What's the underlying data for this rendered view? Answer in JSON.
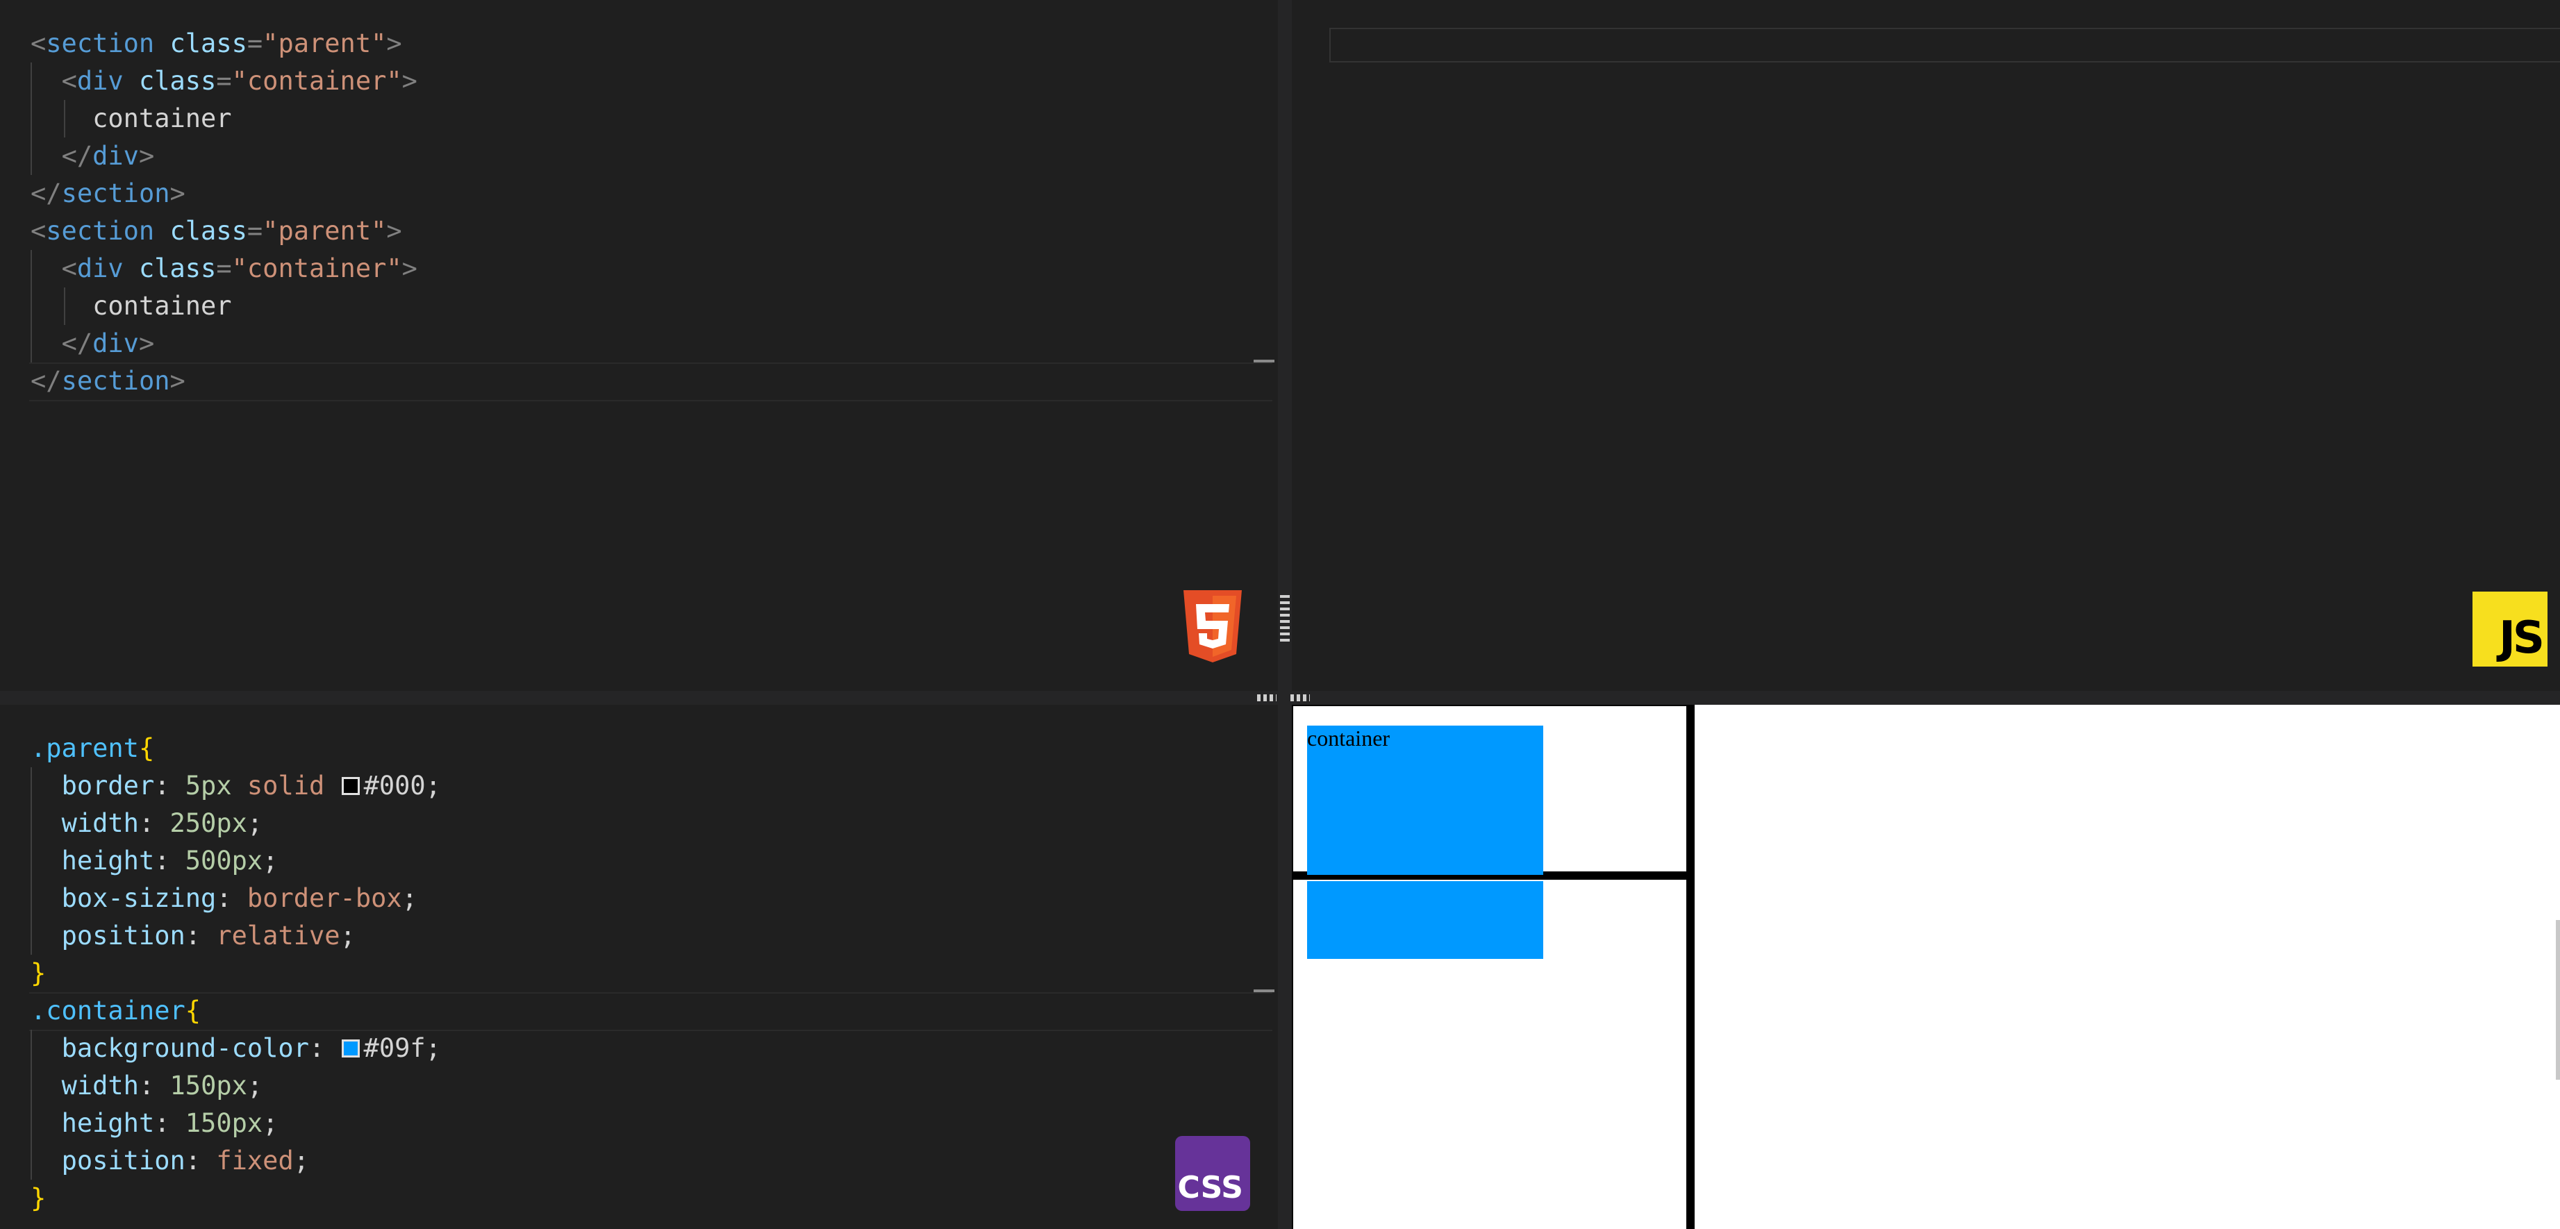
{
  "html_editor": {
    "lines": [
      [
        {
          "t": "punct",
          "v": "<"
        },
        {
          "t": "tag",
          "v": "section"
        },
        {
          "t": "text",
          "v": " "
        },
        {
          "t": "attr",
          "v": "class"
        },
        {
          "t": "punct",
          "v": "="
        },
        {
          "t": "str",
          "v": "\"parent\""
        },
        {
          "t": "punct",
          "v": ">"
        }
      ],
      [
        {
          "t": "text",
          "v": "  "
        },
        {
          "t": "punct",
          "v": "<"
        },
        {
          "t": "tag",
          "v": "div"
        },
        {
          "t": "text",
          "v": " "
        },
        {
          "t": "attr",
          "v": "class"
        },
        {
          "t": "punct",
          "v": "="
        },
        {
          "t": "str",
          "v": "\"container\""
        },
        {
          "t": "punct",
          "v": ">"
        }
      ],
      [
        {
          "t": "text",
          "v": "    container"
        }
      ],
      [
        {
          "t": "text",
          "v": "  "
        },
        {
          "t": "punct",
          "v": "</"
        },
        {
          "t": "tag",
          "v": "div"
        },
        {
          "t": "punct",
          "v": ">"
        }
      ],
      [
        {
          "t": "punct",
          "v": "</"
        },
        {
          "t": "tag",
          "v": "section"
        },
        {
          "t": "punct",
          "v": ">"
        }
      ],
      [
        {
          "t": "punct",
          "v": "<"
        },
        {
          "t": "tag",
          "v": "section"
        },
        {
          "t": "text",
          "v": " "
        },
        {
          "t": "attr",
          "v": "class"
        },
        {
          "t": "punct",
          "v": "="
        },
        {
          "t": "str",
          "v": "\"parent\""
        },
        {
          "t": "punct",
          "v": ">"
        }
      ],
      [
        {
          "t": "text",
          "v": "  "
        },
        {
          "t": "punct",
          "v": "<"
        },
        {
          "t": "tag",
          "v": "div"
        },
        {
          "t": "text",
          "v": " "
        },
        {
          "t": "attr",
          "v": "class"
        },
        {
          "t": "punct",
          "v": "="
        },
        {
          "t": "str",
          "v": "\"container\""
        },
        {
          "t": "punct",
          "v": ">"
        }
      ],
      [
        {
          "t": "text",
          "v": "    container"
        }
      ],
      [
        {
          "t": "text",
          "v": "  "
        },
        {
          "t": "punct",
          "v": "</"
        },
        {
          "t": "tag",
          "v": "div"
        },
        {
          "t": "punct",
          "v": ">"
        }
      ],
      [
        {
          "t": "punct",
          "v": "</"
        },
        {
          "t": "tag",
          "v": "section"
        },
        {
          "t": "punct",
          "v": ">"
        }
      ]
    ],
    "badge_icon": "html5-icon"
  },
  "css_editor": {
    "lines": [
      [
        {
          "t": "class",
          "v": ".parent"
        },
        {
          "t": "brace",
          "v": "{"
        }
      ],
      [
        {
          "t": "text",
          "v": "  "
        },
        {
          "t": "attr",
          "v": "border"
        },
        {
          "t": "text",
          "v": ": "
        },
        {
          "t": "num",
          "v": "5px"
        },
        {
          "t": "text",
          "v": " "
        },
        {
          "t": "val",
          "v": "solid"
        },
        {
          "t": "text",
          "v": " "
        },
        {
          "t": "swatch",
          "v": "#000000"
        },
        {
          "t": "text",
          "v": "#000;"
        }
      ],
      [
        {
          "t": "text",
          "v": "  "
        },
        {
          "t": "attr",
          "v": "width"
        },
        {
          "t": "text",
          "v": ": "
        },
        {
          "t": "num",
          "v": "250px"
        },
        {
          "t": "text",
          "v": ";"
        }
      ],
      [
        {
          "t": "text",
          "v": "  "
        },
        {
          "t": "attr",
          "v": "height"
        },
        {
          "t": "text",
          "v": ": "
        },
        {
          "t": "num",
          "v": "500px"
        },
        {
          "t": "text",
          "v": ";"
        }
      ],
      [
        {
          "t": "text",
          "v": "  "
        },
        {
          "t": "attr",
          "v": "box-sizing"
        },
        {
          "t": "text",
          "v": ": "
        },
        {
          "t": "val",
          "v": "border-box"
        },
        {
          "t": "text",
          "v": ";"
        }
      ],
      [
        {
          "t": "text",
          "v": "  "
        },
        {
          "t": "attr",
          "v": "position"
        },
        {
          "t": "text",
          "v": ": "
        },
        {
          "t": "val",
          "v": "relative"
        },
        {
          "t": "text",
          "v": ";"
        }
      ],
      [
        {
          "t": "brace",
          "v": "}"
        }
      ],
      [
        {
          "t": "class",
          "v": ".container"
        },
        {
          "t": "brace",
          "v": "{"
        }
      ],
      [
        {
          "t": "text",
          "v": "  "
        },
        {
          "t": "attr",
          "v": "background-color"
        },
        {
          "t": "text",
          "v": ": "
        },
        {
          "t": "swatch",
          "v": "#0099ff"
        },
        {
          "t": "text",
          "v": "#09f;"
        }
      ],
      [
        {
          "t": "text",
          "v": "  "
        },
        {
          "t": "attr",
          "v": "width"
        },
        {
          "t": "text",
          "v": ": "
        },
        {
          "t": "num",
          "v": "150px"
        },
        {
          "t": "text",
          "v": ";"
        }
      ],
      [
        {
          "t": "text",
          "v": "  "
        },
        {
          "t": "attr",
          "v": "height"
        },
        {
          "t": "text",
          "v": ": "
        },
        {
          "t": "num",
          "v": "150px"
        },
        {
          "t": "text",
          "v": ";"
        }
      ],
      [
        {
          "t": "text",
          "v": "  "
        },
        {
          "t": "attr",
          "v": "position"
        },
        {
          "t": "text",
          "v": ": "
        },
        {
          "t": "val",
          "v": "fixed"
        },
        {
          "t": "text",
          "v": ";"
        }
      ],
      [
        {
          "t": "brace",
          "v": "}"
        }
      ]
    ],
    "badge_label": "CSS"
  },
  "js_editor": {
    "badge_label": "JS"
  },
  "preview": {
    "container_label": "container",
    "colors": {
      "container": "#0099ff",
      "border": "#000000"
    }
  }
}
